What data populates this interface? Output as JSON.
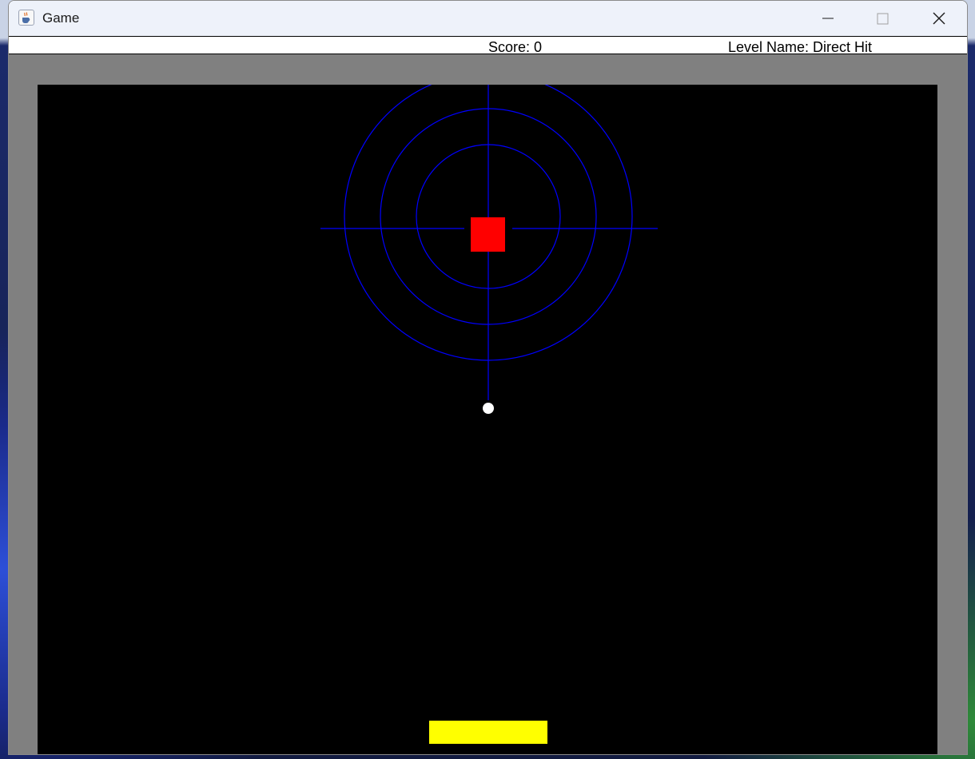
{
  "window": {
    "title": "Game",
    "app_icon": "java-cup-icon",
    "controls": [
      "minimize-icon",
      "maximize-icon",
      "close-icon"
    ]
  },
  "status": {
    "score_text": "Score: 0",
    "level_text": "Level Name: Direct Hit"
  },
  "game": {
    "score": 0,
    "level_name": "Direct Hit",
    "colors": {
      "background": "#000000",
      "border": "#808080",
      "target_rings": "#0000ff",
      "block": "#ff0000",
      "ball": "#ffffff",
      "paddle": "#ffff00"
    },
    "target_rings_count": 3,
    "blocks_count": 1,
    "balls_count": 1
  }
}
